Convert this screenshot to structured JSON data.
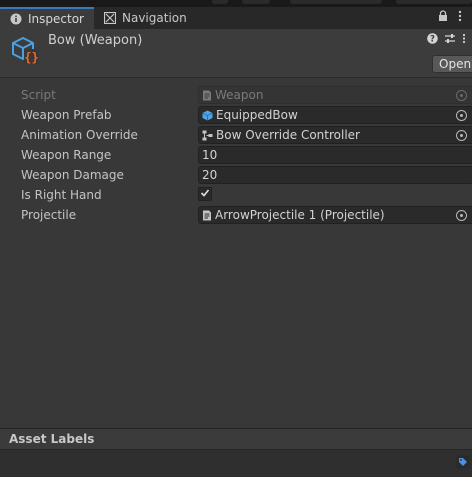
{
  "tabs": [
    {
      "label": "Inspector",
      "icon": "info-icon",
      "active": true
    },
    {
      "label": "Navigation",
      "icon": "navigation-icon",
      "active": false
    }
  ],
  "tabbar_icons": [
    "lock-icon",
    "more-menu-icon"
  ],
  "header": {
    "title": "Bow (Weapon)",
    "icon": "scriptable-object-icon",
    "open_label": "Open",
    "icons": [
      "help-icon",
      "preset-icon",
      "more-icon"
    ]
  },
  "properties": [
    {
      "label": "Script",
      "value": "Weapon",
      "type": "object",
      "icon": "script-icon",
      "disabled": true
    },
    {
      "label": "Weapon Prefab",
      "value": "EquippedBow",
      "type": "object",
      "icon": "prefab-icon"
    },
    {
      "label": "Animation Override",
      "value": "Bow Override Controller",
      "type": "object",
      "icon": "animator-override-icon"
    },
    {
      "label": "Weapon Range",
      "value": "10",
      "type": "number"
    },
    {
      "label": "Weapon Damage",
      "value": "20",
      "type": "number"
    },
    {
      "label": "Is Right Hand",
      "value": "true",
      "type": "checkbox"
    },
    {
      "label": "Projectile",
      "value": "ArrowProjectile 1 (Projectile)",
      "type": "object",
      "icon": "script-icon"
    }
  ],
  "asset_labels": {
    "title": "Asset Labels",
    "icon": "tag-icon"
  },
  "colors": {
    "accent": "#3a79bb",
    "background": "#383838",
    "field": "#2a2a2a"
  }
}
